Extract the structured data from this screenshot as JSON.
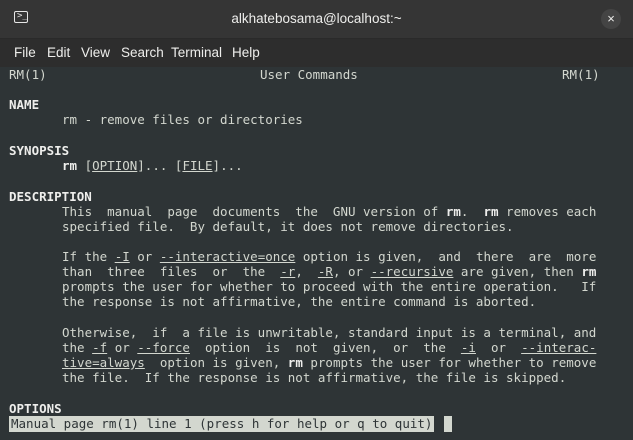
{
  "window": {
    "title": "alkhatebosama@localhost:~",
    "terminal_icon_glyph": ">_",
    "close_glyph": "×"
  },
  "menu": [
    "File",
    "Edit",
    "View",
    "Search",
    "Terminal",
    "Help"
  ],
  "man": {
    "header_left": "RM(1)",
    "header_center": "User Commands",
    "header_right": "RM(1)",
    "name_heading": "NAME",
    "name_line": "rm - remove files or directories",
    "synopsis_heading": "SYNOPSIS",
    "synopsis": {
      "cmd": "rm",
      "p1": " [",
      "option": "OPTION",
      "p2": "]... [",
      "file": "FILE",
      "p3": "]..."
    },
    "description_heading": "DESCRIPTION",
    "desc1": {
      "a": "This  manual  page  documents  the  GNU version of ",
      "b1": "rm",
      "c": ".  ",
      "b2": "rm",
      "d": " removes each",
      "line2": "specified file.  By default, it does not remove directories."
    },
    "desc2": {
      "l1a": "If the ",
      "l1u1": "-I",
      "l1b": " or ",
      "l1u2": "--interactive=once",
      "l1c": " option is given,  and  there  are  more",
      "l2a": "than  three  files  or  the  ",
      "l2u1": "-r",
      "l2b": ",  ",
      "l2u2": "-R",
      "l2c": ", or ",
      "l2u3": "--recursive",
      "l2d": " are given, then ",
      "l2bold": "rm",
      "l3": "prompts the user for whether to proceed with the entire operation.   If",
      "l4": "the response is not affirmative, the entire command is aborted."
    },
    "desc3": {
      "l1": "Otherwise,  if  a file is unwritable, standard input is a terminal, and",
      "l2a": "the ",
      "l2u1": "-f",
      "l2b": " or ",
      "l2u2": "--force",
      "l2c": "  option  is  not  given,  or  the  ",
      "l2u3": "-i",
      "l2d": "  or  ",
      "l2u4": "--interac-",
      "l3u": "tive=always",
      "l3a": "  option is given, ",
      "l3bold": "rm",
      "l3b": " prompts the user for whether to remove",
      "l4": "the file.  If the response is not affirmative, the file is skipped."
    },
    "options_heading": "OPTIONS",
    "status": "Manual page rm(1) line 1 (press h for help or q to quit)"
  }
}
